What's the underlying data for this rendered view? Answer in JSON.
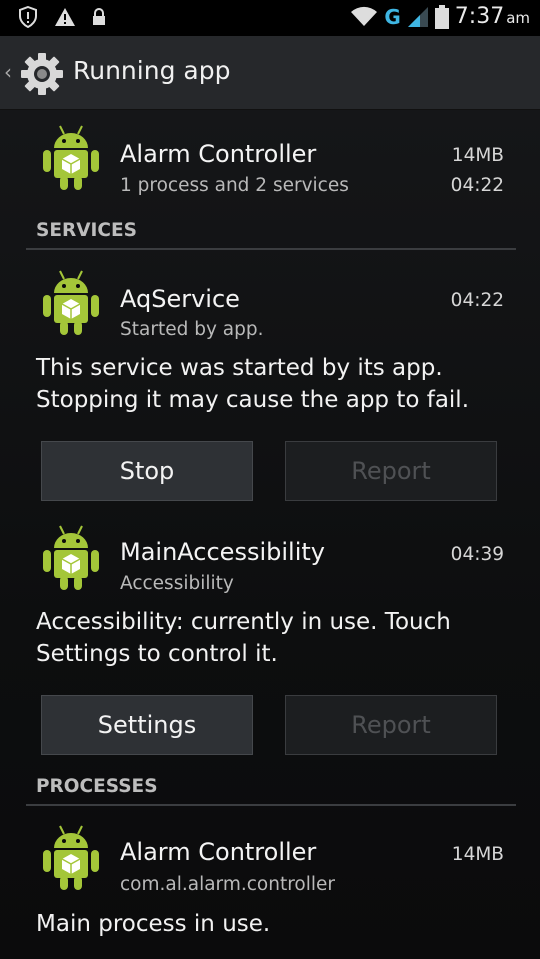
{
  "status_bar": {
    "time": "7:37",
    "ampm": "am",
    "network": "G",
    "icons": [
      "shield-alert-icon",
      "warning-icon",
      "lock-icon",
      "wifi-icon",
      "signal-icon",
      "battery-icon"
    ]
  },
  "action_bar": {
    "title": "Running app",
    "icon": "settings-gear-icon"
  },
  "app": {
    "name": "Alarm Controller",
    "summary": "1 process and 2 services",
    "memory": "14MB",
    "uptime": "04:22"
  },
  "services": {
    "header": "SERVICES",
    "items": [
      {
        "name": "AqService",
        "subtitle": "Started by app.",
        "time": "04:22",
        "description": "This service was started by its app. Stopping it may cause the app to fail.",
        "primary_button": "Stop",
        "secondary_button": "Report"
      },
      {
        "name": "MainAccessibility",
        "subtitle": "Accessibility",
        "time": "04:39",
        "description": "Accessibility: currently in use. Touch Settings to control it.",
        "primary_button": "Settings",
        "secondary_button": "Report"
      }
    ]
  },
  "processes": {
    "header": "PROCESSES",
    "items": [
      {
        "name": "Alarm Controller",
        "subtitle": "com.al.alarm.controller",
        "memory": "14MB",
        "description": "Main process in use."
      }
    ]
  },
  "colors": {
    "android_green": "#a4c639",
    "accent_blue": "#3fb6e3",
    "background": "#0b0b0c"
  }
}
